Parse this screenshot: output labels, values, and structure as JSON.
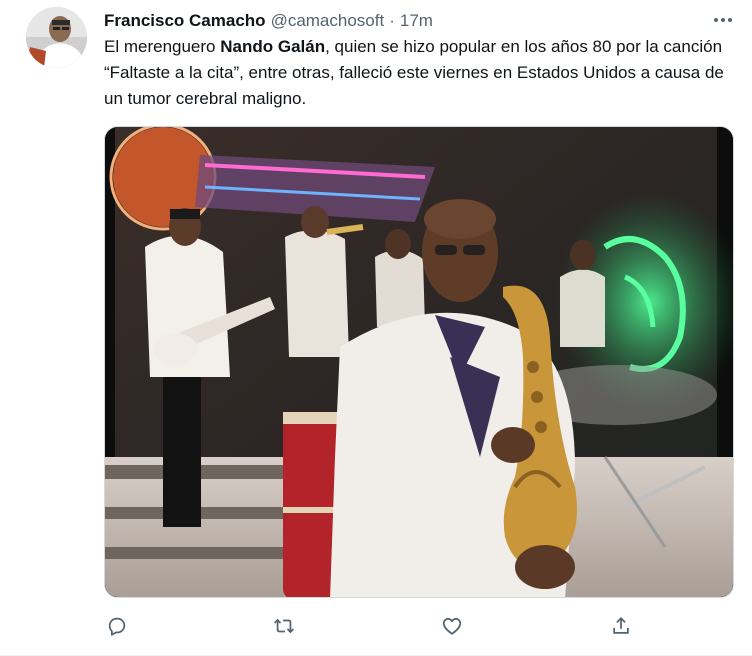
{
  "tweet": {
    "author": {
      "display_name": "Francisco Camacho",
      "handle": "@camachosoft",
      "separator": "·",
      "time": "17m"
    },
    "text": {
      "part1": "El merenguero ",
      "bold": "Nando Galán",
      "part2": ", quien se hizo popular en los años 80 por la canción “Faltaste a la cita”, entre otras, falleció este viernes en Estados Unidos a causa de un tumor cerebral maligno."
    },
    "media_type": "photo",
    "actions": [
      {
        "name": "reply",
        "icon": "reply-icon"
      },
      {
        "name": "retweet",
        "icon": "retweet-icon"
      },
      {
        "name": "like",
        "icon": "heart-icon"
      },
      {
        "name": "share",
        "icon": "share-icon"
      }
    ]
  },
  "colors": {
    "text_primary": "#0f1419",
    "text_secondary": "#536471",
    "border": "#cfd9de"
  }
}
